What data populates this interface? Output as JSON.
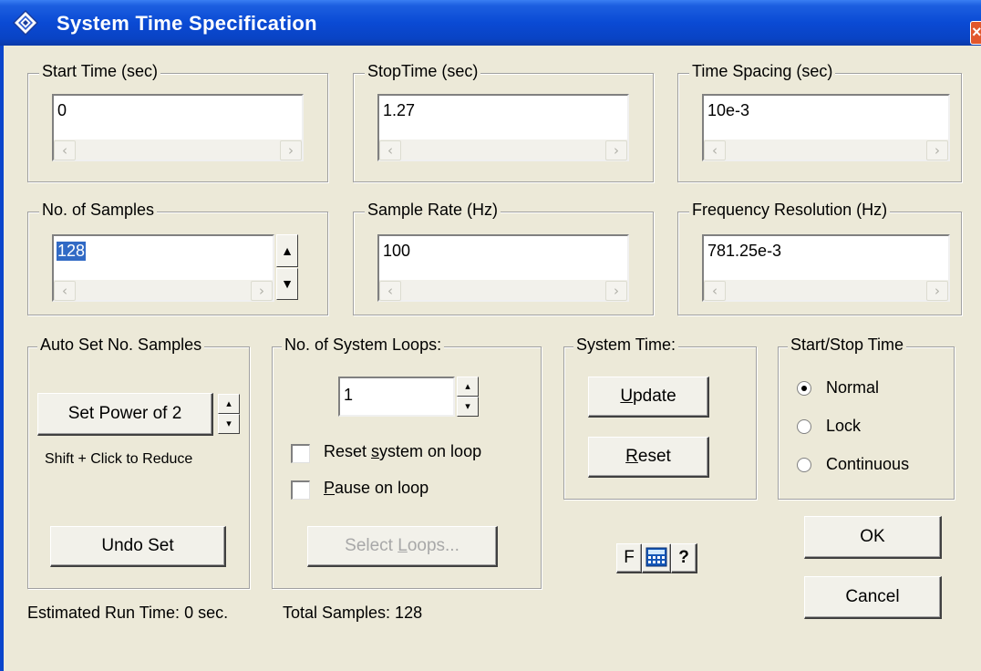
{
  "window": {
    "title": "System Time Specification"
  },
  "fields": {
    "start_time": {
      "label": "Start Time (sec)",
      "value": "0"
    },
    "stop_time": {
      "label": "StopTime (sec)",
      "value": "1.27"
    },
    "time_spacing": {
      "label": "Time Spacing (sec)",
      "value": "10e-3"
    },
    "num_samples": {
      "label": "No. of Samples",
      "value": "128"
    },
    "sample_rate": {
      "label": "Sample Rate (Hz)",
      "value": "100"
    },
    "freq_resolution": {
      "label": "Frequency Resolution (Hz)",
      "value": "781.25e-3"
    }
  },
  "auto_set": {
    "label": "Auto Set No. Samples",
    "set_power_label": "Set Power of 2",
    "hint": "Shift + Click to Reduce",
    "undo_label": "Undo Set"
  },
  "system_loops": {
    "label": "No. of System Loops:",
    "value": "1",
    "reset_pre": "Reset ",
    "reset_key": "s",
    "reset_post": "ystem on loop",
    "reset_checked": false,
    "pause_pre": "",
    "pause_key": "P",
    "pause_post": "ause on loop",
    "pause_checked": false,
    "select_pre": "Select ",
    "select_key": "L",
    "select_post": "oops..."
  },
  "system_time": {
    "label": "System Time:",
    "update_key": "U",
    "update_rest": "pdate",
    "reset_key": "R",
    "reset_rest": "eset"
  },
  "start_stop": {
    "label": "Start/Stop Time",
    "options": [
      "Normal",
      "Lock",
      "Continuous"
    ],
    "selected": "Normal"
  },
  "buttons": {
    "ok": "OK",
    "cancel": "Cancel"
  },
  "tools": {
    "f_label": "F",
    "help_label": "?"
  },
  "status": {
    "run_time": "Estimated Run Time: 0 sec.",
    "total_samples": "Total Samples: 128"
  },
  "icons": [
    "app-icon",
    "close-icon",
    "calculator-icon",
    "chevron-left-icon",
    "chevron-right-icon",
    "spin-up-icon",
    "spin-down-icon"
  ],
  "colors": {
    "titlebar": "#0a4ad4",
    "dialog_bg": "#ece9d8",
    "selection": "#316ac5",
    "close": "#e2572c"
  }
}
